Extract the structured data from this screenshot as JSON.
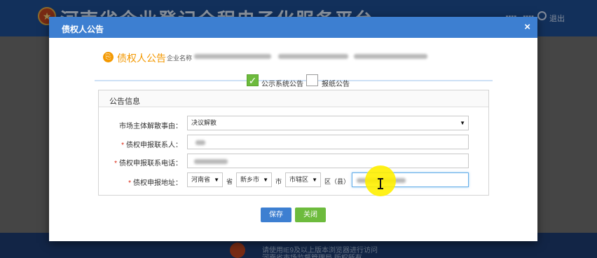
{
  "background": {
    "site_title": "河南省企业登记全程电子化服务平台",
    "logout": "退出",
    "footer_line1": "请使用IE9及以上版本浏览器进行访问",
    "footer_line2": "河南省市场监督管理局 版权所有"
  },
  "modal": {
    "title": "债权人公告",
    "close": "×"
  },
  "section": {
    "title": "债权人公告",
    "company_label": "企业名称"
  },
  "options": [
    {
      "label": "公示系统公告",
      "checked": true
    },
    {
      "label": "报纸公告",
      "checked": false
    }
  ],
  "panel": {
    "title": "公告信息"
  },
  "form": {
    "dissolution_reason": {
      "label": "市场主体解散事由：",
      "value": "决议解散"
    },
    "contact": {
      "label": "债权申报联系人：",
      "required": true
    },
    "phone": {
      "label": "债权申报联系电话：",
      "required": true
    },
    "address": {
      "label": "债权申报地址：",
      "required": true,
      "province": "河南省",
      "province_suffix": "省",
      "city": "新乡市",
      "city_suffix": "市",
      "district": "市辖区",
      "district_suffix": "区（县）"
    }
  },
  "buttons": {
    "save": "保存",
    "close": "关闭"
  },
  "colors": {
    "header": "#3d7fd1",
    "accent": "#f39800",
    "success": "#6dbb3d"
  }
}
